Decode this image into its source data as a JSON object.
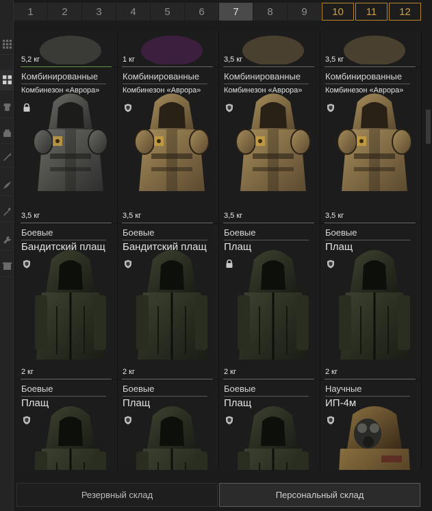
{
  "pager": {
    "pages": [
      "1",
      "2",
      "3",
      "4",
      "5",
      "6",
      "7",
      "8",
      "9",
      "10",
      "11",
      "12"
    ],
    "active": "7"
  },
  "rail": {
    "icons": [
      "grid-icon",
      "grid-icon",
      "armor-icon",
      "suit-icon",
      "knife-icon",
      "wing-icon",
      "tool-icon",
      "wrench-icon",
      "box-icon"
    ]
  },
  "rows": [
    {
      "cells": [
        {
          "weight": "5,2 кг"
        },
        {
          "weight": "1 кг"
        },
        {
          "weight": "3,5 кг"
        },
        {
          "weight": "3,5 кг"
        }
      ]
    },
    {
      "cells": [
        {
          "category": "Комбинированные",
          "name": "Комбинезон «Аврора»",
          "badge": "lock-icon",
          "weight": "3,5 кг"
        },
        {
          "category": "Комбинированные",
          "name": "Комбинезон «Аврора»",
          "badge": "shield-icon",
          "weight": "3,5 кг"
        },
        {
          "category": "Комбинированные",
          "name": "Комбинезон «Аврора»",
          "badge": "shield-icon",
          "weight": "3,5 кг"
        },
        {
          "category": "Комбинированные",
          "name": "Комбинезон «Аврора»",
          "badge": "shield-icon",
          "weight": "3,5 кг"
        }
      ]
    },
    {
      "cells": [
        {
          "category": "Боевые",
          "name": "Бандитский плащ",
          "badge": "shield-icon",
          "weight": "2 кг"
        },
        {
          "category": "Боевые",
          "name": "Бандитский плащ",
          "badge": "shield-icon",
          "weight": "2 кг"
        },
        {
          "category": "Боевые",
          "name": "Плащ",
          "badge": "lock-icon",
          "weight": "2 кг"
        },
        {
          "category": "Боевые",
          "name": "Плащ",
          "badge": "shield-icon",
          "weight": "2 кг"
        }
      ]
    },
    {
      "cells": [
        {
          "category": "Боевые",
          "name": "Плащ",
          "badge": "shield-icon"
        },
        {
          "category": "Боевые",
          "name": "Плащ",
          "badge": "shield-icon"
        },
        {
          "category": "Боевые",
          "name": "Плащ",
          "badge": "shield-icon"
        },
        {
          "category": "Научные",
          "name": "ИП-4м",
          "badge": "shield-icon"
        }
      ]
    }
  ],
  "tabs": {
    "reserve": "Резервный склад",
    "personal": "Персональный склад"
  },
  "colors": {
    "accent_gold": "#d0a040",
    "selected_line": "#6a9a4a"
  }
}
